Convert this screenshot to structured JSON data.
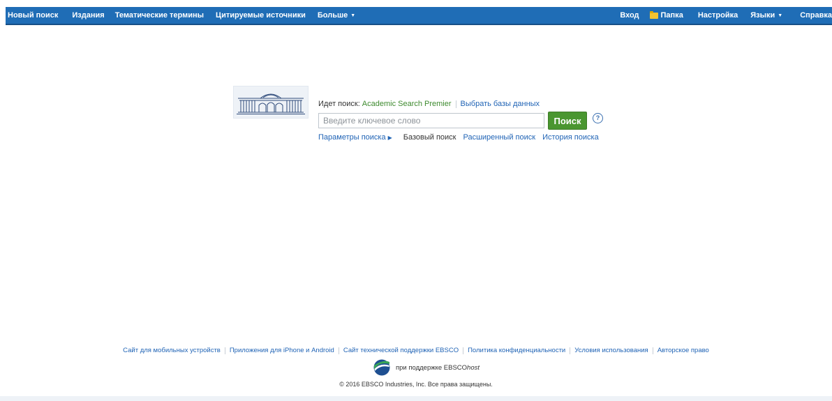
{
  "topnav": {
    "left": [
      {
        "label": "Новый поиск",
        "name": "nav-new-search"
      },
      {
        "label": "Издания",
        "name": "nav-publications"
      },
      {
        "label": "Тематические термины",
        "name": "nav-subject-terms"
      },
      {
        "label": "Цитируемые источники",
        "name": "nav-cited-references"
      },
      {
        "label": "Больше",
        "name": "nav-more",
        "dropdown": true
      }
    ],
    "right": [
      {
        "label": "Вход",
        "name": "nav-sign-in"
      },
      {
        "label": "Папка",
        "name": "nav-folder",
        "icon": "folder-icon"
      },
      {
        "label": "Настройка",
        "name": "nav-preferences"
      },
      {
        "label": "Языки",
        "name": "nav-languages",
        "dropdown": true
      },
      {
        "label": "Справка",
        "name": "nav-help"
      }
    ],
    "colors": {
      "background": "#1f6db6",
      "text": "#ffffff"
    }
  },
  "search": {
    "searching_label": "Идет поиск:",
    "database": "Academic Search Premier",
    "choose_db": "Выбрать базы данных",
    "placeholder": "Введите ключевое слово",
    "value": "",
    "button": "Поиск",
    "help_icon": "?",
    "options_link": "Параметры поиска",
    "basic": "Базовый поиск",
    "advanced": "Расширенный поиск",
    "history": "История поиска",
    "colors": {
      "button": "#4a9630",
      "db_name": "#3d8a2e",
      "link": "#1f63b5"
    }
  },
  "footer": {
    "links": [
      "Сайт для мобильных устройств",
      "Приложения для iPhone и Android",
      "Сайт технической поддержки EBSCO",
      "Политика конфиденциальности",
      "Условия использования",
      "Авторское право"
    ],
    "powered": "при поддержке EBSCO",
    "powered_suffix": "host",
    "copyright": "© 2016 EBSCO Industries, Inc. Все права защищены."
  }
}
